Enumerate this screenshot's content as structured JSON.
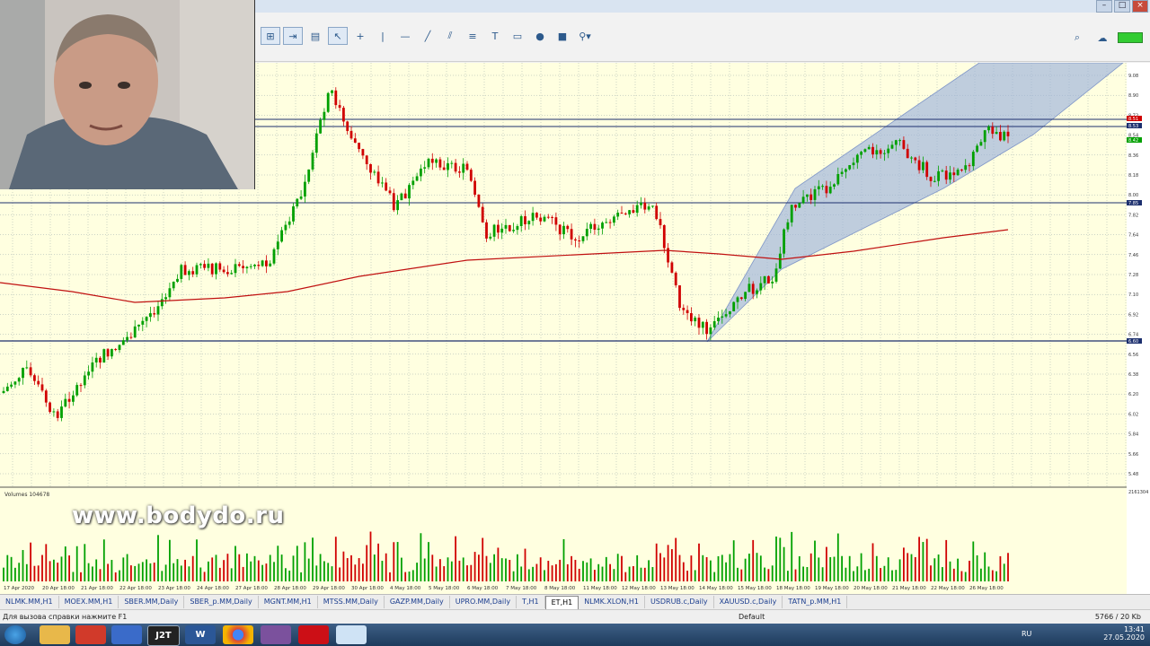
{
  "window": {
    "min": "–",
    "max": "□",
    "close": "×"
  },
  "chart": {
    "price_labels": [
      "9.08",
      "8.90",
      "8.72",
      "8.54",
      "8.36",
      "8.18",
      "8.00",
      "7.82",
      "7.64",
      "7.46",
      "7.28",
      "7.10",
      "6.92",
      "6.74",
      "6.56",
      "6.38",
      "6.20",
      "6.02",
      "5.84",
      "5.66",
      "5.48"
    ],
    "hline_labels": [
      "8.51",
      "8.53",
      "8.42",
      "7.85",
      "6.60"
    ],
    "volume_label": "Volumes 104678",
    "volume_scale": "2161304",
    "time_labels": [
      "17 Apr 2020",
      "20 Apr 18:00",
      "21 Apr 18:00",
      "22 Apr 18:00",
      "23 Apr 18:00",
      "24 Apr 18:00",
      "27 Apr 18:00",
      "28 Apr 18:00",
      "29 Apr 18:00",
      "30 Apr 18:00",
      "4 May 18:00",
      "5 May 18:00",
      "6 May 18:00",
      "7 May 18:00",
      "8 May 18:00",
      "11 May 18:00",
      "12 May 18:00",
      "13 May 18:00",
      "14 May 18:00",
      "15 May 18:00",
      "18 May 18:00",
      "19 May 18:00",
      "20 May 18:00",
      "21 May 18:00",
      "22 May 18:00",
      "26 May 18:00"
    ],
    "colors": {
      "background": "#ffffe0",
      "bull": "#00a000",
      "bear": "#d00000",
      "ma": "#c01010",
      "channel": "#b0c4e6",
      "hline": "#1c2f6e"
    }
  },
  "watermark": "www.bodydo.ru",
  "tabs": [
    "NLMK.MM,H1",
    "MOEX.MM,H1",
    "SBER.MM,Daily",
    "SBER_p.MM,Daily",
    "MGNT.MM,H1",
    "MTSS.MM,Daily",
    "GAZP.MM,Daily",
    "UPRO.MM,Daily",
    "T,H1",
    "ET,H1",
    "NLMK.XLON,H1",
    "USDRUB.c,Daily",
    "XAUUSD.c,Daily",
    "TATN_p.MM,H1"
  ],
  "active_tab": "ET,H1",
  "status": {
    "help": "Для вызова справки нажмите F1",
    "profile": "Default",
    "traffic": "5766 / 20 Kb"
  },
  "taskbar": {
    "apps": [
      "folder",
      "mail",
      "save",
      "J2T",
      "W",
      "chrome",
      "viber",
      "opera",
      "notepad"
    ],
    "lang": "RU",
    "time": "13:41",
    "date": "27.05.2020"
  },
  "icons": {
    "search": "search-icon",
    "start": "windows-start-icon"
  }
}
